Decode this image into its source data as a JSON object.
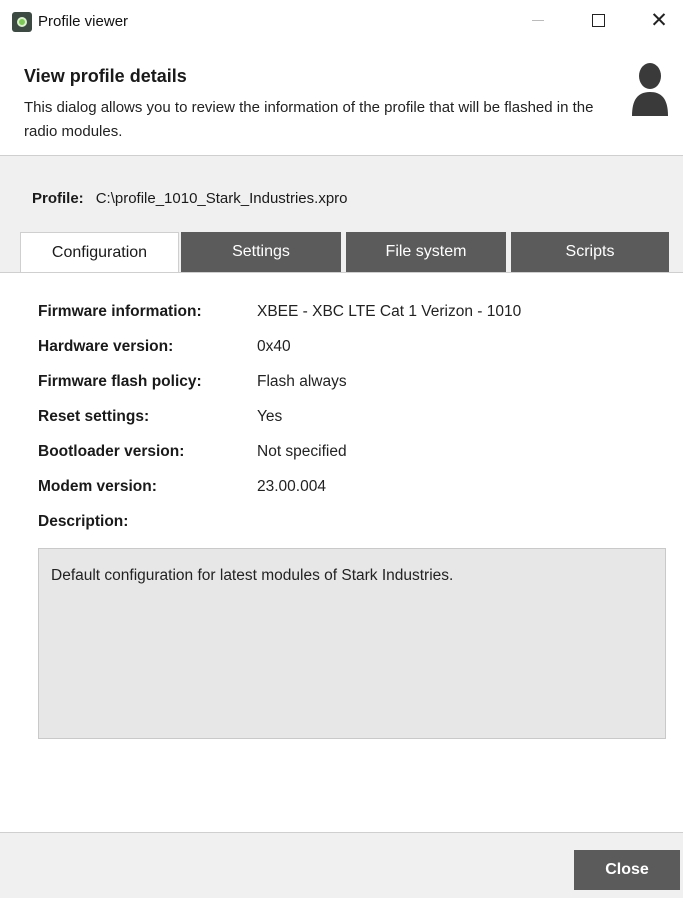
{
  "window": {
    "title": "Profile viewer",
    "icon": "app-gear-icon"
  },
  "header": {
    "title": "View profile details",
    "description": "This dialog allows you to review the information of the profile that will be flashed in the radio modules.",
    "icon": "user-icon"
  },
  "profile": {
    "label": "Profile:",
    "path": "C:\\profile_1010_Stark_Industries.xpro"
  },
  "tabs": [
    {
      "label": "Configuration",
      "active": true
    },
    {
      "label": "Settings",
      "active": false
    },
    {
      "label": "File system",
      "active": false
    },
    {
      "label": "Scripts",
      "active": false
    }
  ],
  "info": [
    {
      "label": "Firmware information:",
      "value": "XBEE - XBC LTE Cat 1 Verizon - 1010"
    },
    {
      "label": "Hardware version:",
      "value": "0x40"
    },
    {
      "label": "Firmware flash policy:",
      "value": "Flash always"
    },
    {
      "label": "Reset settings:",
      "value": "Yes"
    },
    {
      "label": "Bootloader version:",
      "value": "Not specified"
    },
    {
      "label": "Modem version:",
      "value": "23.00.004"
    }
  ],
  "description": {
    "label": "Description:",
    "text": "Default configuration for latest modules of Stark Industries."
  },
  "footer": {
    "close_label": "Close"
  },
  "colors": {
    "tab_inactive": "#5b5b5b",
    "panel_grey": "#f0f0f0",
    "description_box": "#e7e7e7"
  }
}
